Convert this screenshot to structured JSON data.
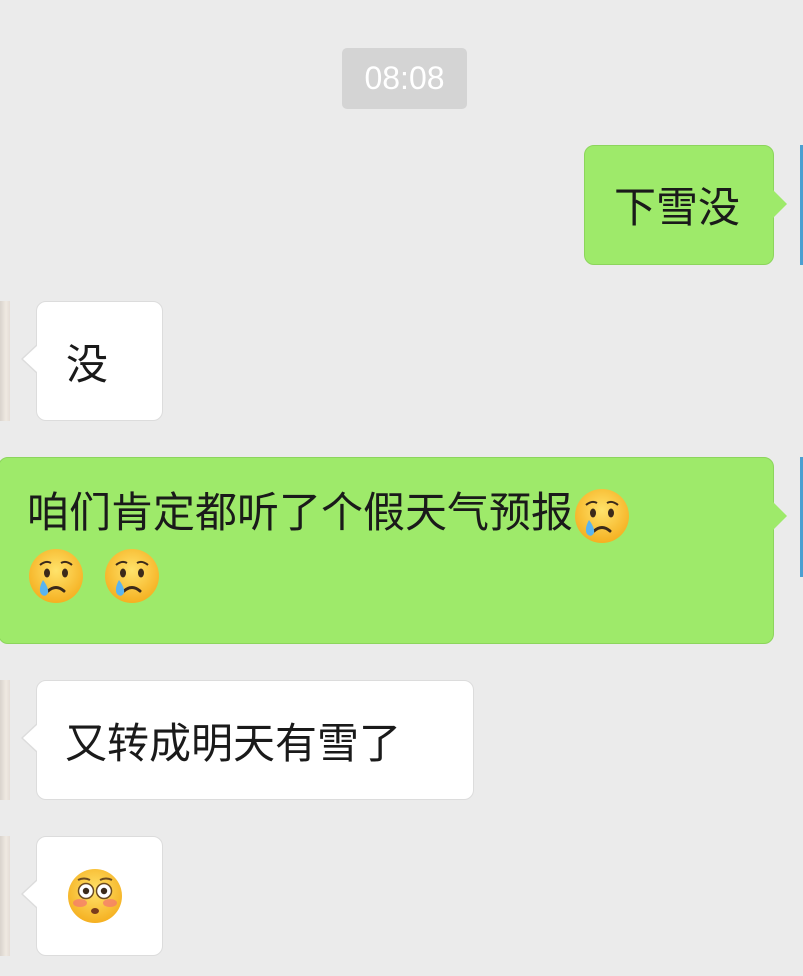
{
  "chat": {
    "timestamp": "08:08",
    "messages": [
      {
        "side": "out",
        "text": "下雪没"
      },
      {
        "side": "in",
        "text": "没"
      },
      {
        "side": "out",
        "text": "咱们肯定都听了个假天气预报",
        "emojis": [
          "crying-face",
          "crying-face",
          "crying-face"
        ]
      },
      {
        "side": "in",
        "text": "又转成明天有雪了"
      },
      {
        "side": "in",
        "text": "",
        "emojis": [
          "flushed-face"
        ]
      }
    ]
  },
  "colors": {
    "background": "#ebebeb",
    "outgoing_bubble": "#9eea6a",
    "incoming_bubble": "#ffffff",
    "timestamp_bg": "#d4d4d4"
  }
}
